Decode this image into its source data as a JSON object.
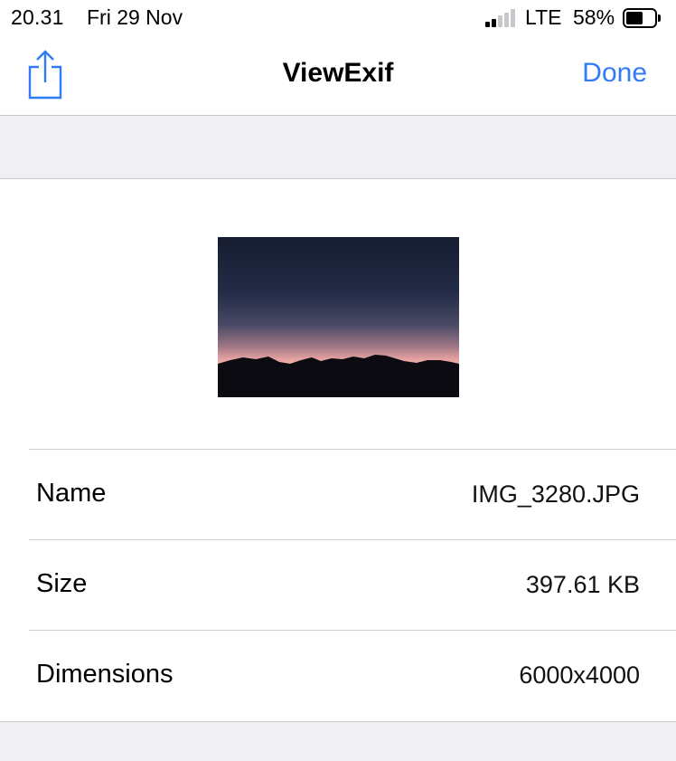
{
  "status_bar": {
    "time": "20.31",
    "date": "Fri 29 Nov",
    "network": "LTE",
    "battery_percent": "58%",
    "battery_level": 0.58,
    "signal_bars_active": 2,
    "signal_bars_total": 5
  },
  "nav": {
    "title": "ViewExif",
    "done_label": "Done",
    "share_icon": "share-icon",
    "accent_color": "#2f7cf6"
  },
  "image": {
    "description_icon": "photo-thumbnail"
  },
  "details": [
    {
      "label": "Name",
      "value": "IMG_3280.JPG"
    },
    {
      "label": "Size",
      "value": "397.61 KB"
    },
    {
      "label": "Dimensions",
      "value": "6000x4000"
    }
  ]
}
